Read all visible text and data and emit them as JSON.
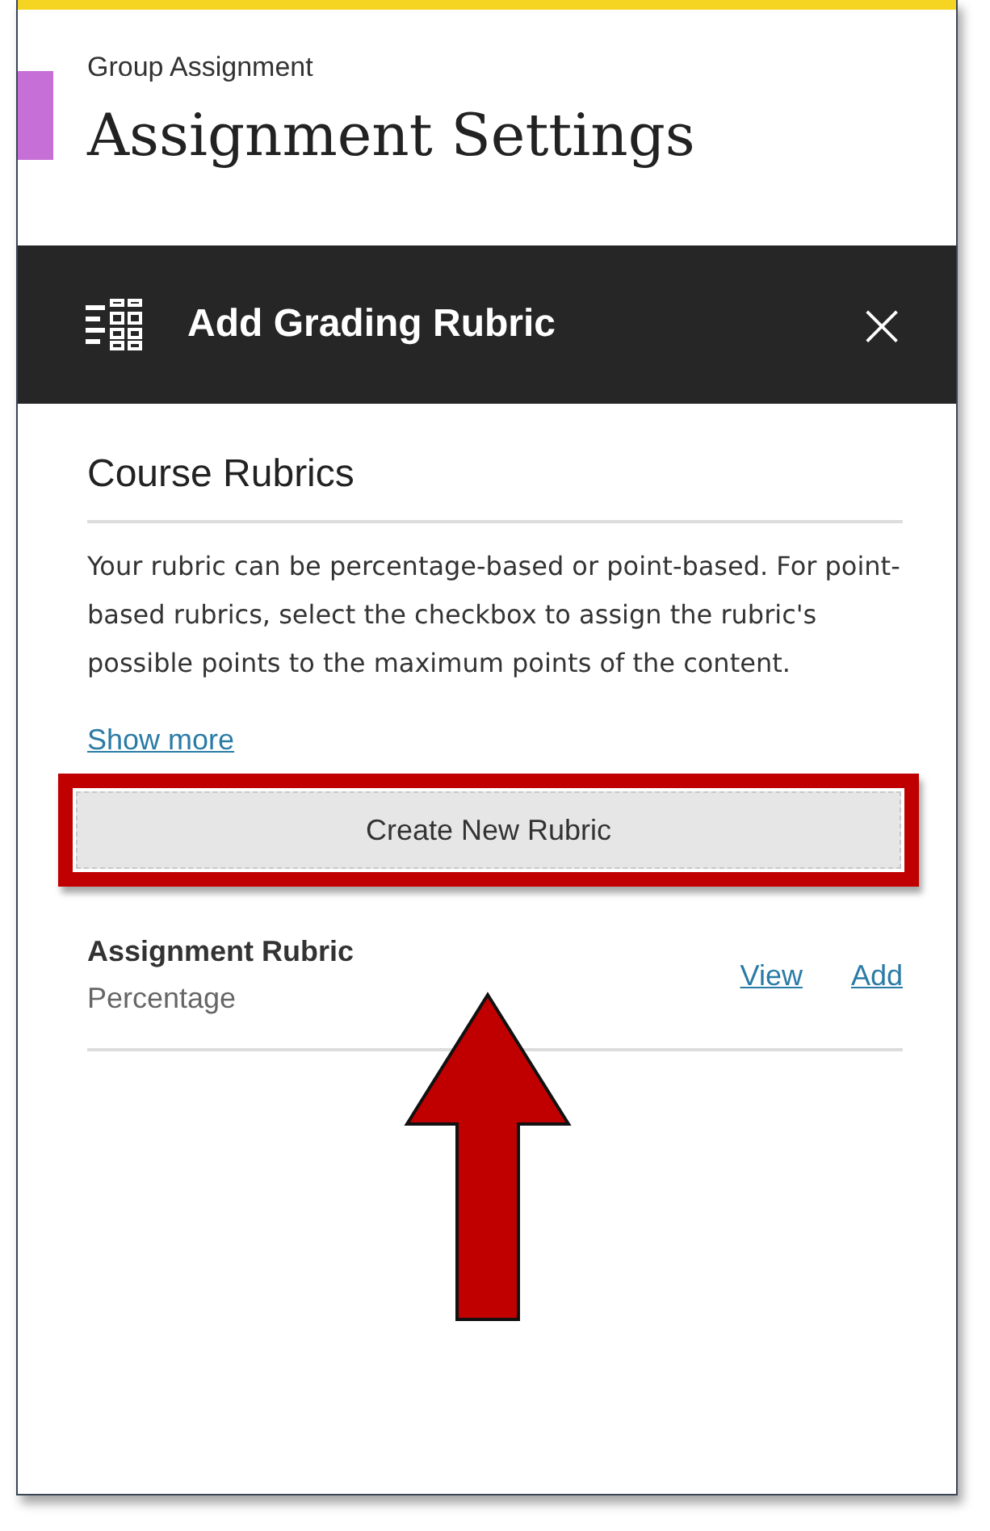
{
  "header": {
    "subtitle": "Group Assignment",
    "title": "Assignment Settings"
  },
  "panel": {
    "title": "Add Grading Rubric",
    "close": "×"
  },
  "section": {
    "title": "Course Rubrics",
    "description": "Your rubric can be percentage-based or point-based. For point-based rubrics, select the checkbox to assign the rubric's possible points to the maximum points of the content.",
    "show_more": "Show more",
    "create_button": "Create New Rubric"
  },
  "rubrics": [
    {
      "name": "Assignment Rubric",
      "type": "Percentage",
      "actions": [
        "View",
        "Add"
      ]
    }
  ]
}
